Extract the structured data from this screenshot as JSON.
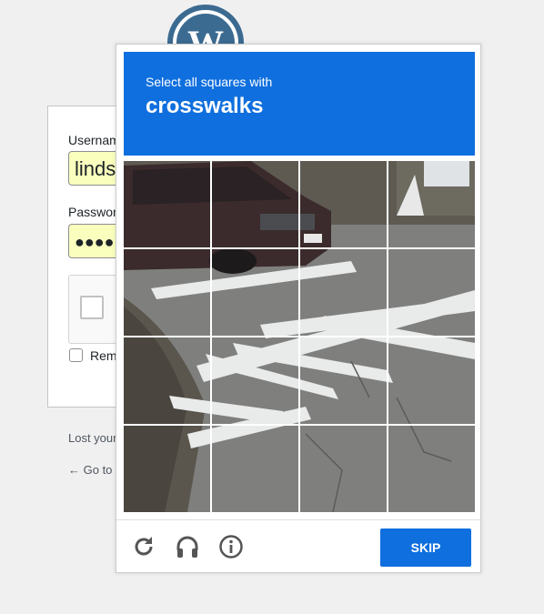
{
  "login": {
    "username_label": "Usernam",
    "username_value": "linds",
    "password_label": "Passwor",
    "password_value": "●●●●",
    "remember_label": "Rem",
    "lost_password_link": "Lost your",
    "back_link": "← Go to"
  },
  "challenge": {
    "instruction": "Select all squares with",
    "target": "crosswalks",
    "grid": {
      "rows": 4,
      "cols": 4
    },
    "footer": {
      "reload_icon": "reload-icon",
      "audio_icon": "headphones-icon",
      "info_icon": "info-icon",
      "skip_label": "SKIP"
    }
  },
  "colors": {
    "accent": "#0f6fde",
    "page_bg": "#f0f0f1",
    "autofill_bg": "#faffbd"
  }
}
